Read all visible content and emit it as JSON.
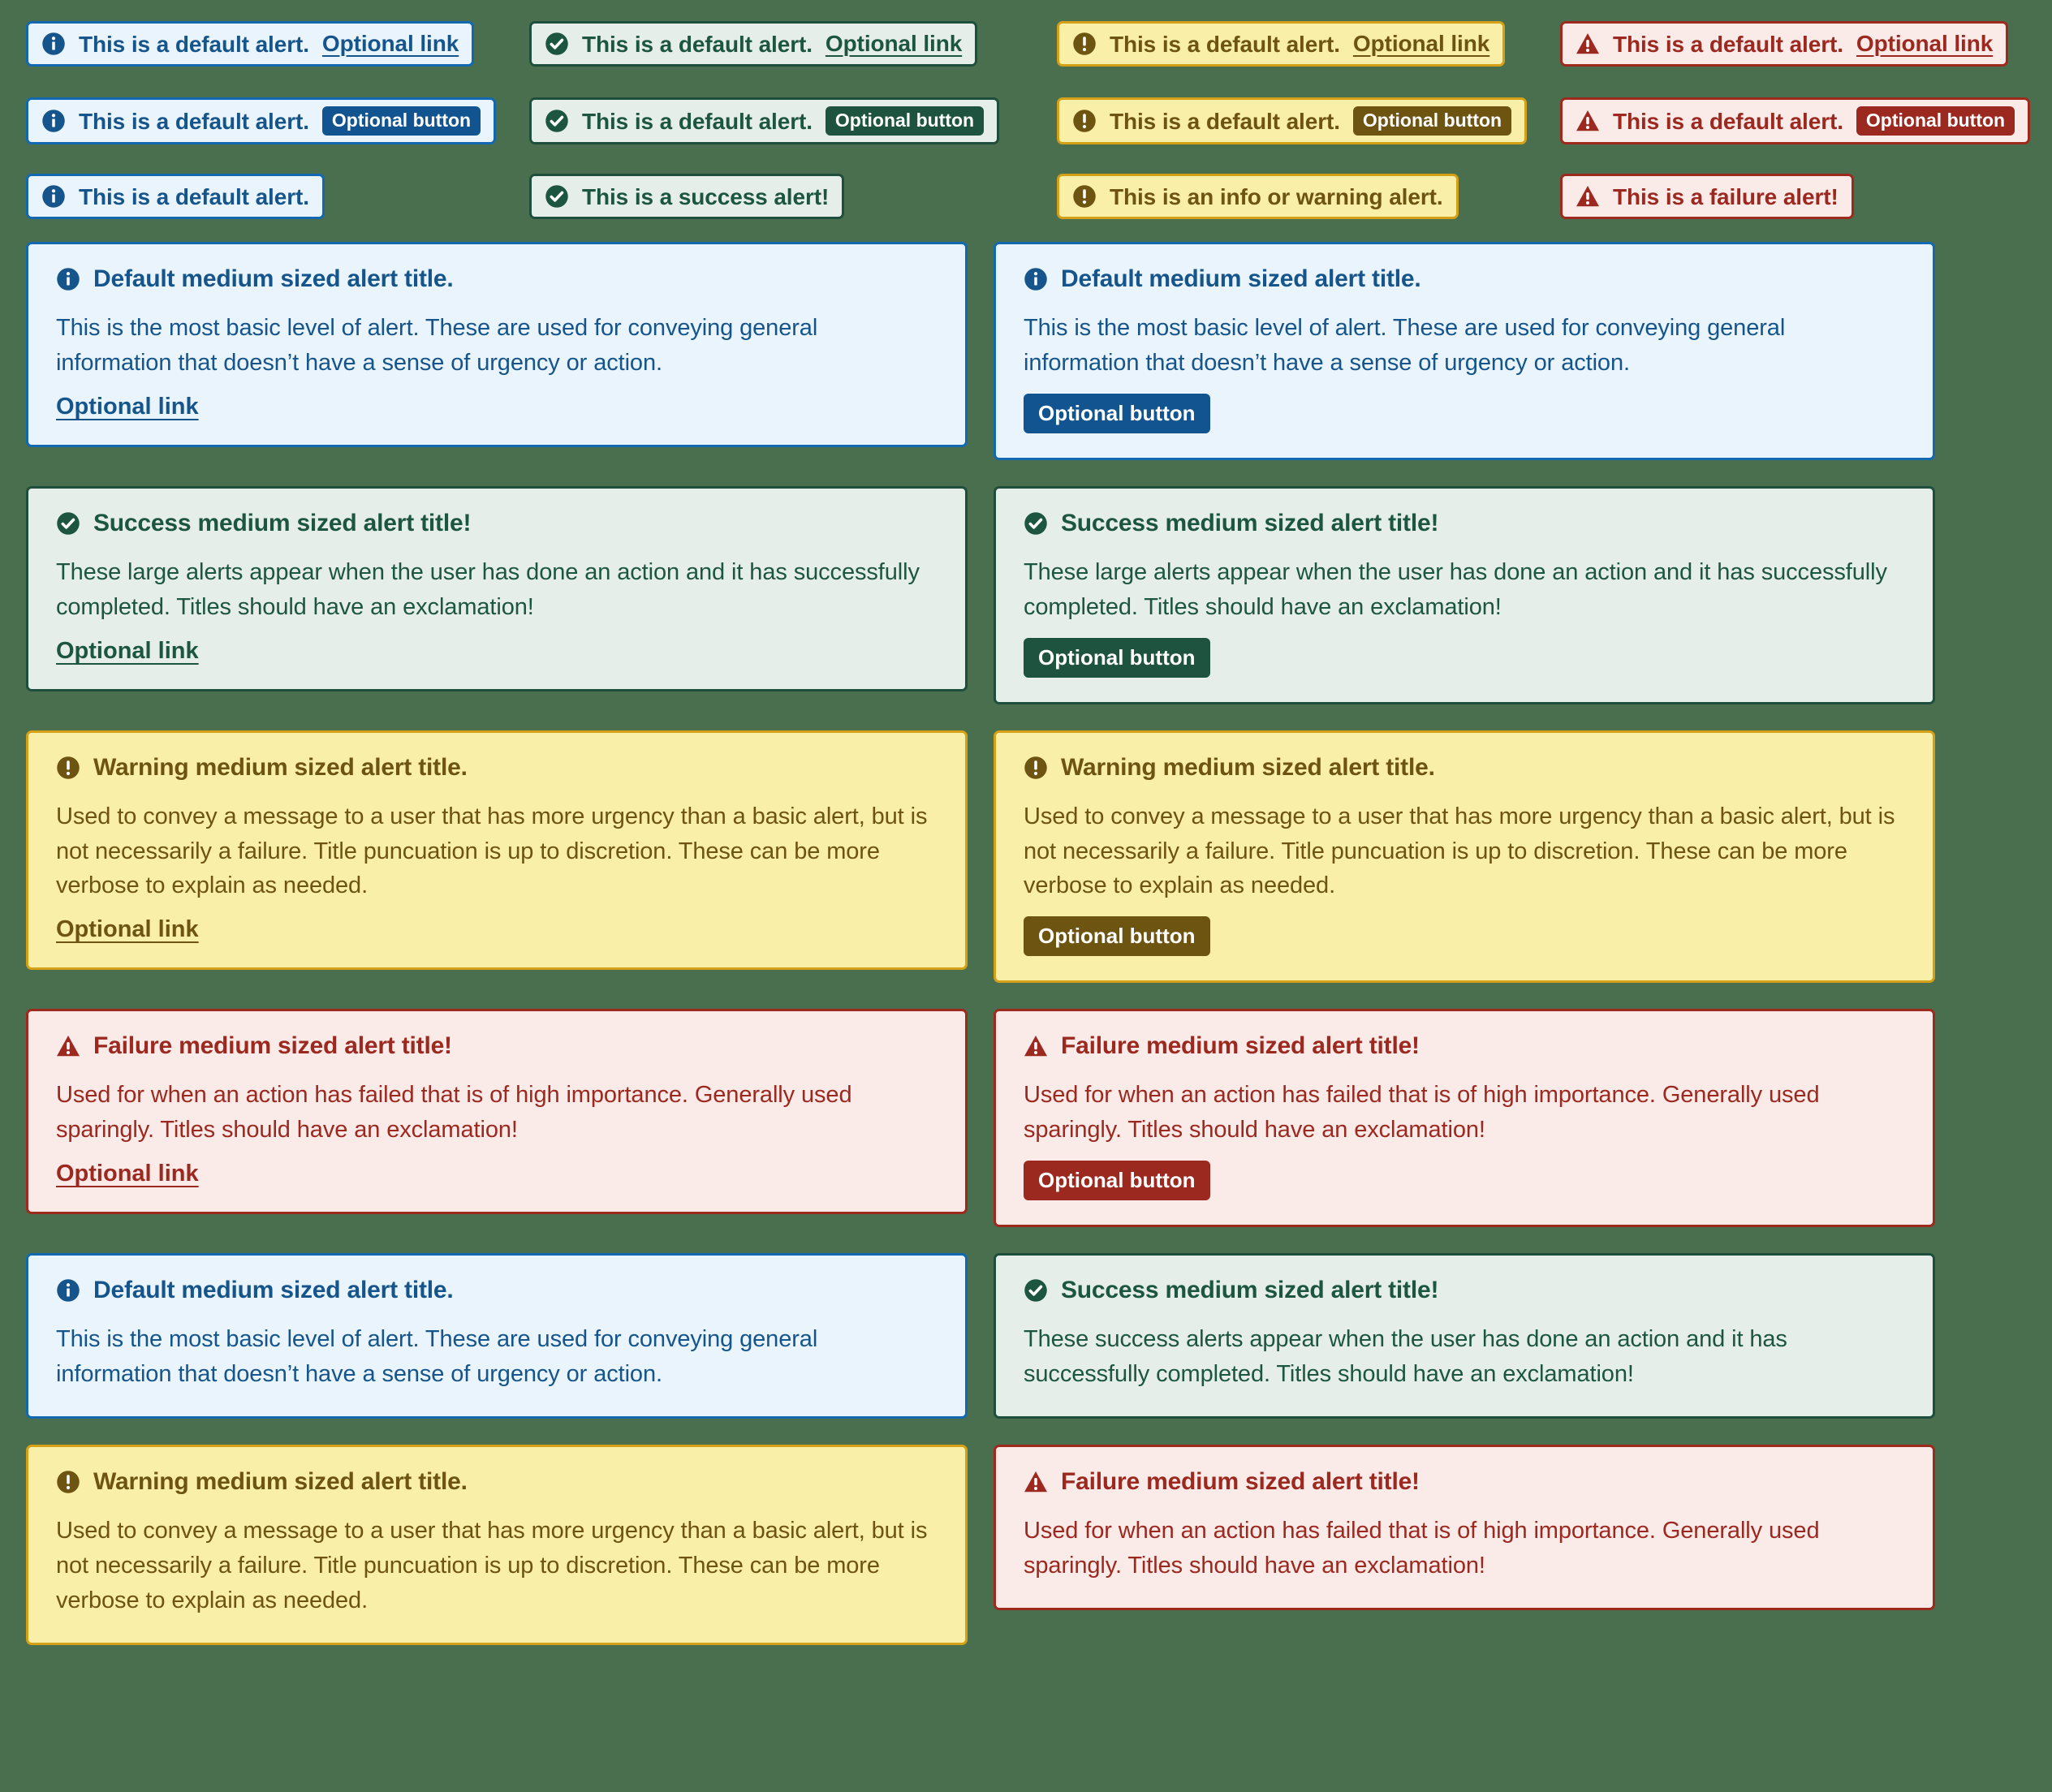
{
  "theme": {
    "page_background": "#4a6f4f",
    "variants": {
      "default": {
        "label": "Default",
        "bg": "#eaf4fc",
        "border": "#1368b2",
        "text": "#15558c",
        "icon": "info-circle-icon"
      },
      "success": {
        "label": "Success",
        "bg": "#e6eeea",
        "border": "#1e4f3c",
        "text": "#1d5640",
        "icon": "check-circle-icon"
      },
      "warning": {
        "label": "Warning",
        "bg": "#faefa8",
        "border": "#d4a017",
        "text": "#6d5410",
        "icon": "exclamation-circle-icon"
      },
      "failure": {
        "label": "Failure",
        "bg": "#faeae8",
        "border": "#9e2a1e",
        "text": "#9c2920",
        "icon": "warning-triangle-icon"
      }
    }
  },
  "labels": {
    "optional_link": "Optional link",
    "optional_button": "Optional button"
  },
  "small_alerts": {
    "rows": [
      {
        "action": "link",
        "cells": [
          {
            "variant": "default",
            "message": "This is a default alert."
          },
          {
            "variant": "success",
            "message": "This is a default alert."
          },
          {
            "variant": "warning",
            "message": "This is a default alert."
          },
          {
            "variant": "failure",
            "message": "This is a default alert."
          }
        ]
      },
      {
        "action": "button",
        "cells": [
          {
            "variant": "default",
            "message": "This is a default alert."
          },
          {
            "variant": "success",
            "message": "This is a default alert."
          },
          {
            "variant": "warning",
            "message": "This is a default alert."
          },
          {
            "variant": "failure",
            "message": "This is a default alert."
          }
        ]
      },
      {
        "action": "none",
        "cells": [
          {
            "variant": "default",
            "message": "This is a default alert."
          },
          {
            "variant": "success",
            "message": "This is a success alert!"
          },
          {
            "variant": "warning",
            "message": "This is an info or warning alert."
          },
          {
            "variant": "failure",
            "message": "This is a failure alert!"
          }
        ]
      }
    ]
  },
  "alert_cards": {
    "rows": [
      [
        {
          "variant": "default",
          "title": "Default medium sized alert title.",
          "body": "This is the most basic level of alert.  These are used for conveying general information that doesn’t have a sense of urgency or action.",
          "action": "link",
          "action_label": "Optional link"
        },
        {
          "variant": "default",
          "title": "Default medium sized alert title.",
          "body": "This is the most basic level of alert.  These are used for conveying general information that doesn’t have a sense of urgency or action.",
          "action": "button",
          "action_label": "Optional button"
        }
      ],
      [
        {
          "variant": "success",
          "title": "Success medium sized alert title!",
          "body": "These large alerts appear when the user has done an action and it has successfully completed.  Titles should have an exclamation!",
          "action": "link",
          "action_label": "Optional link"
        },
        {
          "variant": "success",
          "title": "Success medium sized alert title!",
          "body": "These large alerts appear when the user has done an action and it has successfully completed.  Titles should have an exclamation!",
          "action": "button",
          "action_label": "Optional button"
        }
      ],
      [
        {
          "variant": "warning",
          "title": "Warning medium sized alert title.",
          "body": "Used to convey a message to a user that has more urgency than a basic alert, but is not necessarily a failure.  Title puncuation is up to discretion.  These can be more verbose to explain as needed.",
          "action": "link",
          "action_label": "Optional link"
        },
        {
          "variant": "warning",
          "title": "Warning medium sized alert title.",
          "body": "Used to convey a message to a user that has more urgency than a basic alert, but is not necessarily a failure.  Title puncuation is up to discretion.  These can be more verbose to explain as needed.",
          "action": "button",
          "action_label": "Optional button"
        }
      ],
      [
        {
          "variant": "failure",
          "title": "Failure medium sized alert title!",
          "body": "Used for when an action has failed that is of high importance.  Generally used sparingly.  Titles should have an exclamation!",
          "action": "link",
          "action_label": "Optional link"
        },
        {
          "variant": "failure",
          "title": "Failure medium sized alert title!",
          "body": "Used for when an action has failed that is of high importance.  Generally used sparingly.  Titles should have an exclamation!",
          "action": "button",
          "action_label": "Optional button"
        }
      ],
      [
        {
          "variant": "default",
          "title": "Default medium sized alert title.",
          "body": "This is the most basic level of alert.  These are used for conveying general information that doesn’t have a sense of urgency or action.",
          "action": "none",
          "action_label": ""
        },
        {
          "variant": "success",
          "title": "Success medium sized alert title!",
          "body": "These success alerts appear when the user has done an action and it has successfully completed.  Titles should have an exclamation!",
          "action": "none",
          "action_label": ""
        }
      ],
      [
        {
          "variant": "warning",
          "title": "Warning medium sized alert title.",
          "body": "Used to convey a message to a user that has more urgency than a basic alert, but is not necessarily a failure.  Title puncuation is up to discretion.  These can be more verbose to explain as needed.",
          "action": "none",
          "action_label": ""
        },
        {
          "variant": "failure",
          "title": "Failure medium sized alert title!",
          "body": "Used for when an action has failed that is of high importance.  Generally used sparingly.  Titles should have an exclamation!",
          "action": "none",
          "action_label": ""
        }
      ]
    ]
  }
}
